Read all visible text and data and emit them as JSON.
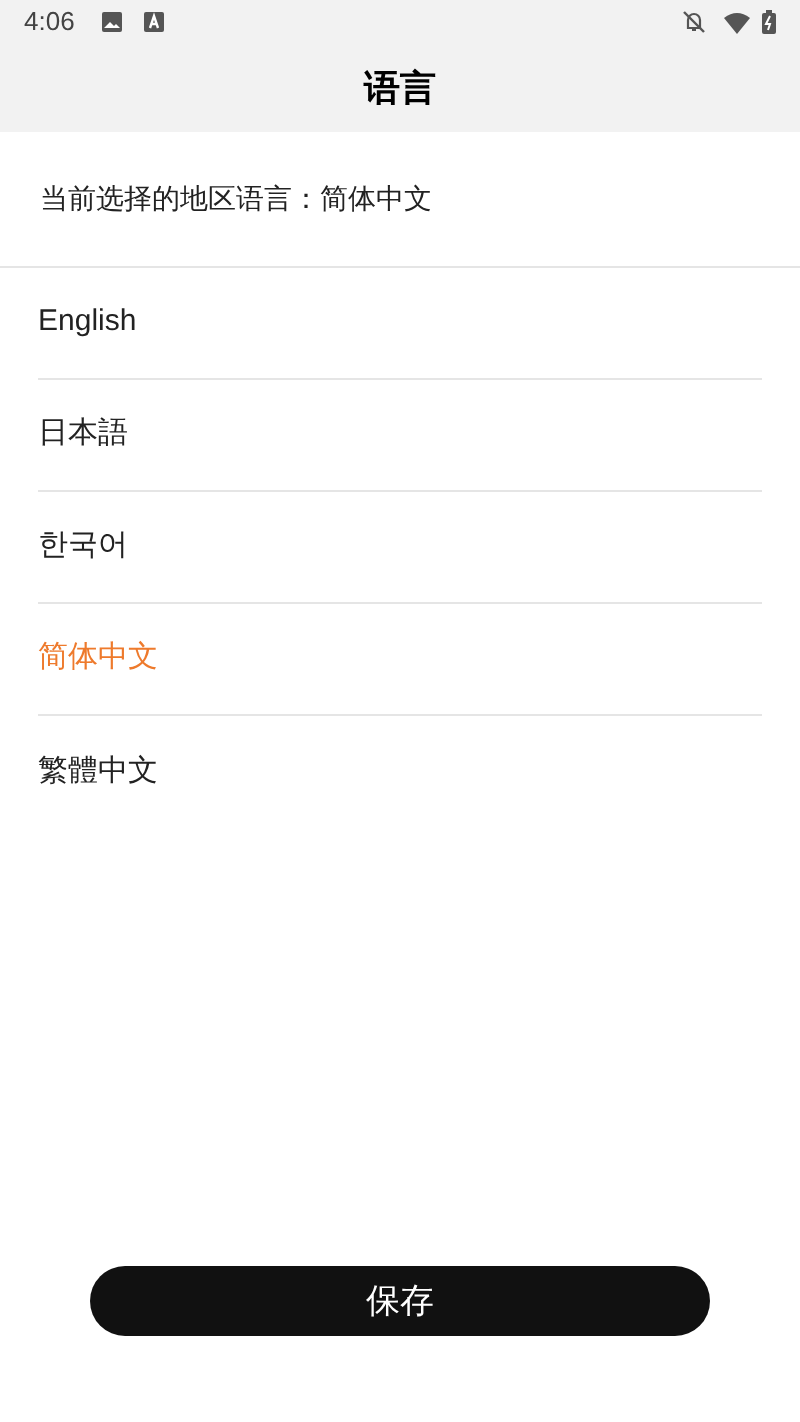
{
  "status_bar": {
    "time": "4:06"
  },
  "header": {
    "title": "语言"
  },
  "current": {
    "text": "当前选择的地区语言：简体中文"
  },
  "languages": [
    {
      "label": "English",
      "selected": false
    },
    {
      "label": "日本語",
      "selected": false
    },
    {
      "label": "한국어",
      "selected": false
    },
    {
      "label": "简体中文",
      "selected": true
    },
    {
      "label": "繁體中文",
      "selected": false
    }
  ],
  "save_button": {
    "label": "保存"
  }
}
